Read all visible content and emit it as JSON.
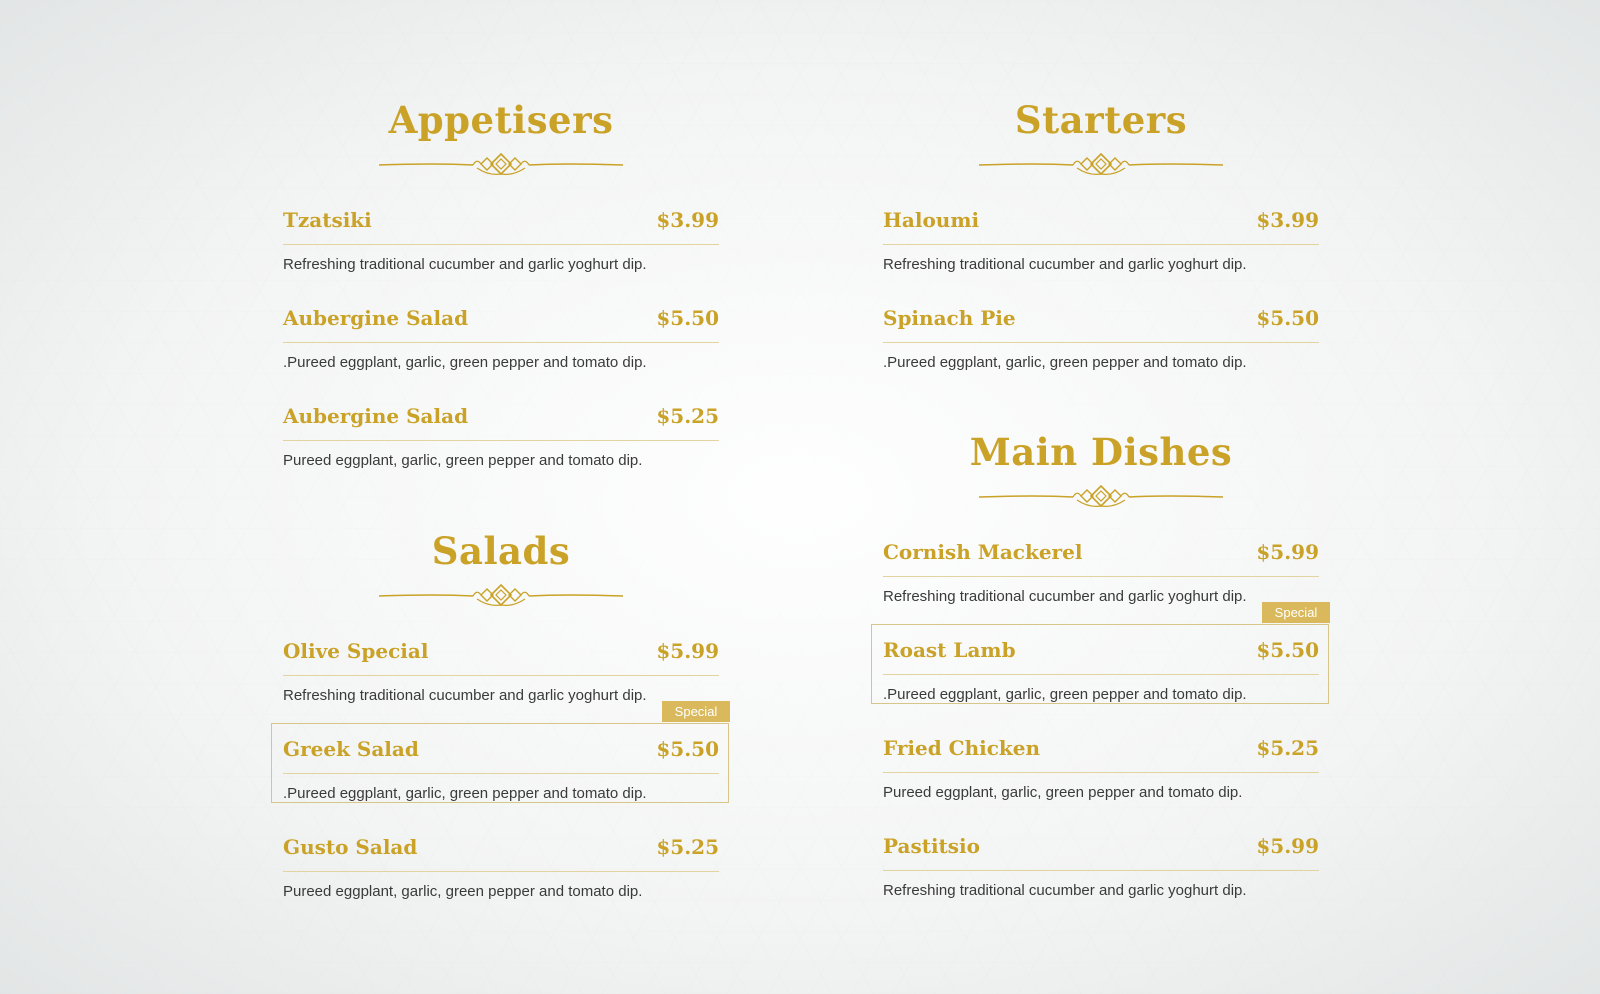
{
  "colors": {
    "accent": "#c9a227",
    "text": "#3a3a3a",
    "rule": "#e2d3a1",
    "badge": "#d9b95c"
  },
  "sections": {
    "appetisers": {
      "title": "Appetisers",
      "items": [
        {
          "name": "Tzatsiki",
          "price": "$3.99",
          "desc": "Refreshing traditional cucumber and garlic yoghurt dip."
        },
        {
          "name": "Aubergine Salad",
          "price": "$5.50",
          "desc": ".Pureed eggplant, garlic, green pepper and tomato dip."
        },
        {
          "name": "Aubergine Salad",
          "price": "$5.25",
          "desc": "Pureed eggplant, garlic, green pepper and tomato dip."
        }
      ]
    },
    "salads": {
      "title": "Salads",
      "items": [
        {
          "name": "Olive Special",
          "price": "$5.99",
          "desc": "Refreshing traditional cucumber and garlic yoghurt dip."
        },
        {
          "name": "Greek Salad",
          "price": "$5.50",
          "desc": ".Pureed eggplant, garlic, green pepper and tomato dip.",
          "badge": "Special"
        },
        {
          "name": "Gusto Salad",
          "price": "$5.25",
          "desc": "Pureed eggplant, garlic, green pepper and tomato dip."
        }
      ]
    },
    "starters": {
      "title": "Starters",
      "items": [
        {
          "name": "Haloumi",
          "price": "$3.99",
          "desc": "Refreshing traditional cucumber and garlic yoghurt dip."
        },
        {
          "name": "Spinach Pie",
          "price": "$5.50",
          "desc": ".Pureed eggplant, garlic, green pepper and tomato dip."
        }
      ]
    },
    "main_dishes": {
      "title": "Main Dishes",
      "items": [
        {
          "name": "Cornish Mackerel",
          "price": "$5.99",
          "desc": "Refreshing traditional cucumber and garlic yoghurt dip."
        },
        {
          "name": "Roast Lamb",
          "price": "$5.50",
          "desc": ".Pureed eggplant, garlic, green pepper and tomato dip.",
          "badge": "Special"
        },
        {
          "name": "Fried Chicken",
          "price": "$5.25",
          "desc": "Pureed eggplant, garlic, green pepper and tomato dip."
        },
        {
          "name": "Pastitsio",
          "price": "$5.99",
          "desc": "Refreshing traditional cucumber and garlic yoghurt dip."
        }
      ]
    }
  }
}
